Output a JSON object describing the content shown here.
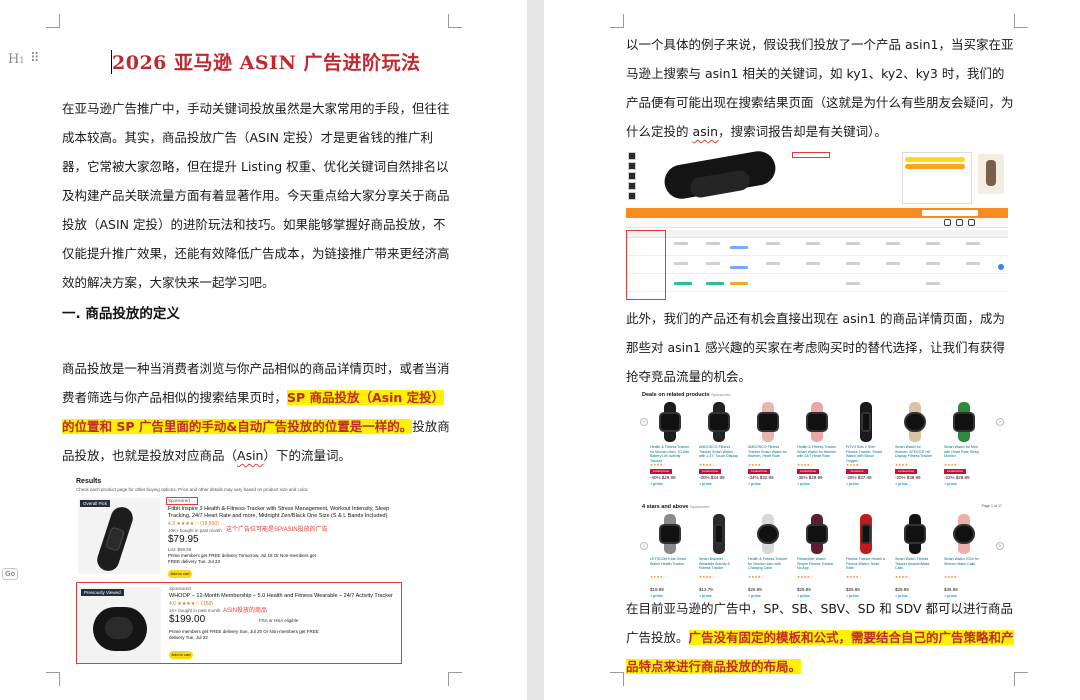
{
  "left_page": {
    "title": "2026 亚马逊 ASIN 广告进阶玩法",
    "intro_text": "在亚马逊广告推广中，手动关键词投放虽然是大家常用的手段，但往往成本较高。其实，商品投放广告（ASIN 定投）才是更省钱的推广利器，它常被大家忽略，但在提升 Listing 权重、优化关键词自然排名以及构建产品关联流量方面有着显著作用。今天重点给大家分享关于商品投放（ASIN 定投）的进阶玩法和技巧。如果能够掌握好商品投放，不仅能提升推广效果，还能有效降低广告成本，为链接推广带来更经济高效的解决方案，大家快来一起学习吧。",
    "section_heading": "一. 商品投放的定义",
    "def_text_before": "商品投放是一种当消费者浏览与你产品相似的商品详情页时，或者当消费者筛选与你产品相似的搜索结果页时，",
    "def_text_highlight": "SP 商品投放（Asin 定投）的位置和 SP 广告里面的手动&自动广告投放的位置是一样的。",
    "def_text_after_1": "投放商品投放，也就是投放对应商品（",
    "def_text_squiggle": "Asin",
    "def_text_after_2": "）下的流量词。",
    "screenshot_results": {
      "heading": "Results",
      "subheading": "Check each product page for other buying options. Price and other details may vary based on product size and color.",
      "card1": {
        "badge": "Overall Pick",
        "sponsored": "Sponsored",
        "title": "Fitbit Inspire 3 Health &-Fitness-Tracker with Stress Management, Workout Intensity, Sleep Tracking, 24/7 Heart Rate and more, Midnight Zen/Black One Size (S & L Bands Included)",
        "rating": "4.3 ★★★★☆ (19,560)",
        "bought": "10K+ bought in past month",
        "price": "$79.95",
        "list_price": "List: $99.95",
        "delivery": "Prime members get FREE delivery Tomorrow, Jul 18 Or Non-members get FREE delivery Tue, Jul 23",
        "button": "Add to cart",
        "annotation": "这个广告位可能是SP/ASIN投放的广告"
      },
      "card2": {
        "badge": "Previously Viewed",
        "sponsored": "Sponsored",
        "title": "WHOOP – 12-Month Membership – 5.0 Health and Fitness Wearable – 24/7 Activity Tracker",
        "rating": "4.0 ★★★★☆ (158)",
        "bought": "1K+ bought in past month",
        "price": "$199.00",
        "fsa": "FSA or HSA eligible",
        "delivery": "Prime members get FREE delivery Sun, Jul 20 Or Non-members get FREE delivery Tue, Jul 22",
        "button": "Add to cart",
        "annotation": "ASIN投放的商品"
      }
    },
    "side_tab_label": "Go"
  },
  "right_page": {
    "para1_before": "以一个具体的例子来说，假设我们投放了一个产品 asin1，当买家在亚马逊上搜索与 asin1 相关的关键词，如 ky1、ky2、ky3 时，我们的产品便有可能出现在搜索结果页面（这就是为什么有些朋友会疑问，为什么定投的 ",
    "para1_squiggle": "asin",
    "para1_after": "，搜索词报告却是有关键词）。",
    "para2": "此外，我们的产品还有机会直接出现在 asin1 的商品详情页面，成为那些对 asin1 感兴趣的买家在考虑购买时的替代选择，让我们有获得抢夺竞品流量的机会。",
    "para3_before": "在目前亚马逊的广告中，SP、SB、SBV、SD 和 SDV 都可以进行商品广告投放。",
    "para3_highlight": "广告没有固定的模板和公式，需要结合自己的广告策略和产品特点来进行商品投放的布局。",
    "screenshot_deals": {
      "row1_heading": "Deals on related products",
      "row1_sponsored": "Sponsored",
      "row2_heading": "4 stars and above",
      "row2_sponsored": "Sponsored",
      "row2_page": "Page 1 of 17",
      "items_row1": [
        {
          "title": "Health & Fitness Tracker for Women Men, 10-Day Battery Life Activity Tracker",
          "price": "-40% $29.99",
          "deal": "Limited time deal",
          "strap": "#1c1c1c",
          "face": "square"
        },
        {
          "title": "AMDOSCO Fitness Tracker Smart Watch with 1.47\" Touch Display",
          "price": "-30% $34.99",
          "deal": "Limited time deal",
          "strap": "#222222",
          "face": "square"
        },
        {
          "title": "AMDOSCO Fitness Tracker Smart Watch for Women, Heart Rate",
          "price": "-34% $32.99",
          "deal": "Limited time deal",
          "strap": "#e8b4b0",
          "face": "square"
        },
        {
          "title": "Health & Fitness Tracker Smart Watch for Women with 24/7 Heart Rate",
          "price": "-35% $29.99",
          "deal": "Limited time deal",
          "strap": "#e8a9a6",
          "face": "square"
        },
        {
          "title": "FITVII Slim 2 Slim Fitness Tracker, Smart Watch with Blood Oxygen",
          "price": "-25% $37.49",
          "deal": "Amazon's Choice",
          "strap": "#1a1a1a",
          "face": "band"
        },
        {
          "title": "Smart Watch for Women, AFEGGE HD Display Fitness Tracker",
          "price": "-20% $39.99",
          "deal": "Limited time deal",
          "strap": "#d8c3a2",
          "face": "round"
        },
        {
          "title": "Smart Watch for Men with Heart Rate Sleep Monitor",
          "price": "-22% $28.99",
          "deal": "Limited time deal",
          "strap": "#2f8a3c",
          "face": "square"
        }
      ],
      "items_row2": [
        {
          "title": "LETSCOM Kids Smart Watch Health Tracker",
          "price": "$19.99",
          "deal": "",
          "strap": "#8a8a8a",
          "face": "square"
        },
        {
          "title": "Smart Bracelet Wearable Activity & Fitness Tracker",
          "price": "$12.79",
          "deal": "",
          "strap": "#2b2b2b",
          "face": "band"
        },
        {
          "title": "Health & Fitness Tracker for Women Men with Charging Case",
          "price": "$26.99",
          "deal": "",
          "strap": "#d9d9d9",
          "face": "round"
        },
        {
          "title": "Pedometer Watch Simple Fitness Tracker No App",
          "price": "$29.99",
          "deal": "",
          "strap": "#5a2030",
          "face": "square"
        },
        {
          "title": "Fitness Tracker Health & Fitness Watch, Heart Rate",
          "price": "$25.99",
          "deal": "",
          "strap": "#c01c1c",
          "face": "band"
        },
        {
          "title": "Smart Watch Fitness Tracker Answer/Make Calls",
          "price": "$29.99",
          "deal": "",
          "strap": "#111111",
          "face": "square"
        },
        {
          "title": "Smart Watch 2024 for Women Make Calls",
          "price": "$36.99",
          "deal": "",
          "strap": "#eab0a8",
          "face": "round"
        }
      ]
    }
  }
}
